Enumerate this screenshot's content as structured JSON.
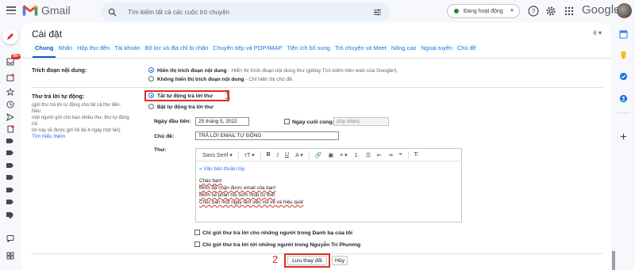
{
  "app": {
    "title": "Gmail",
    "google_word": "Google"
  },
  "search": {
    "placeholder": "Tìm kiếm tất cả các cuộc trò chuyện"
  },
  "status": {
    "label": "Đang hoạt động",
    "color": "#1e8e3e"
  },
  "rail": {
    "inbox_badge": "99+"
  },
  "settings": {
    "title": "Cài đặt",
    "toggle": "ê ▾",
    "tabs": [
      "Chung",
      "Nhãn",
      "Hộp thư đến",
      "Tài khoản",
      "Bộ lọc và địa chỉ bị chặn",
      "Chuyển tiếp và POP/IMAP",
      "Tiện ích bổ sung",
      "Trò chuyện và Meet",
      "Nâng cao",
      "Ngoại tuyến",
      "Chủ đề"
    ],
    "active_tab": "Chung"
  },
  "snippets": {
    "label": "Trích đoạn nội dung:",
    "option1_bold": "Hiển thị trích đoạn nội dung",
    "option1_rest": " - Hiển thị trích đoạn nội dung thư (giống Tìm kiếm trên web của Google!).",
    "option2_bold": "Không hiển thị trích đoạn nội dung",
    "option2_rest": " - Chỉ hiển thị chủ đề.",
    "selected": 1
  },
  "vacation": {
    "label": "Thư trả lời tự động:",
    "desc_lines": [
      "(gửi thư trả lời tự động cho tất cả thư đến. Nếu",
      "một người gửi cho bạn nhiều thư, thư tự động trả",
      "lời này sẽ được gửi tối đa 4 ngày một lần)"
    ],
    "learn_more": "Tìm hiểu thêm",
    "off_label": "Tắt tự động trả lời thư",
    "on_label": "Bật tự động trả lời thư",
    "selected": "off",
    "first_day_label": "Ngày đầu tiên:",
    "first_day_value": "25 tháng 5, 2022",
    "last_day_label": "Ngày cuối cùng:",
    "last_day_placeholder": "(tùy chọn)",
    "subject_label": "Chủ đề:",
    "subject_value": "TRẢ LỜI EMAIL TỰ ĐỘNG",
    "message_label": "Thư:",
    "font_name": "Sans Serif",
    "plain_text_link": "« Văn bản thuần túy",
    "body_lines": [
      "Chào bạn!",
      "Mình đã nhận được email của bạn!",
      "Mình sẽ phản hồi sớm nhất có thể!",
      "Chúc bạn một ngày làm việc vui vẻ và hiệu quả!"
    ],
    "contacts_only": "Chỉ gửi thư trả lời cho những người trong Danh bạ của tôi",
    "domain_only": "Chỉ gửi thư trả lời tới những người trong Nguyễn Trí Phương"
  },
  "footer": {
    "save_label": "Lưu thay đổi",
    "cancel_label": "Hủy"
  },
  "annotations": {
    "step1": "1",
    "step2": "2",
    "color": "#d93025"
  }
}
